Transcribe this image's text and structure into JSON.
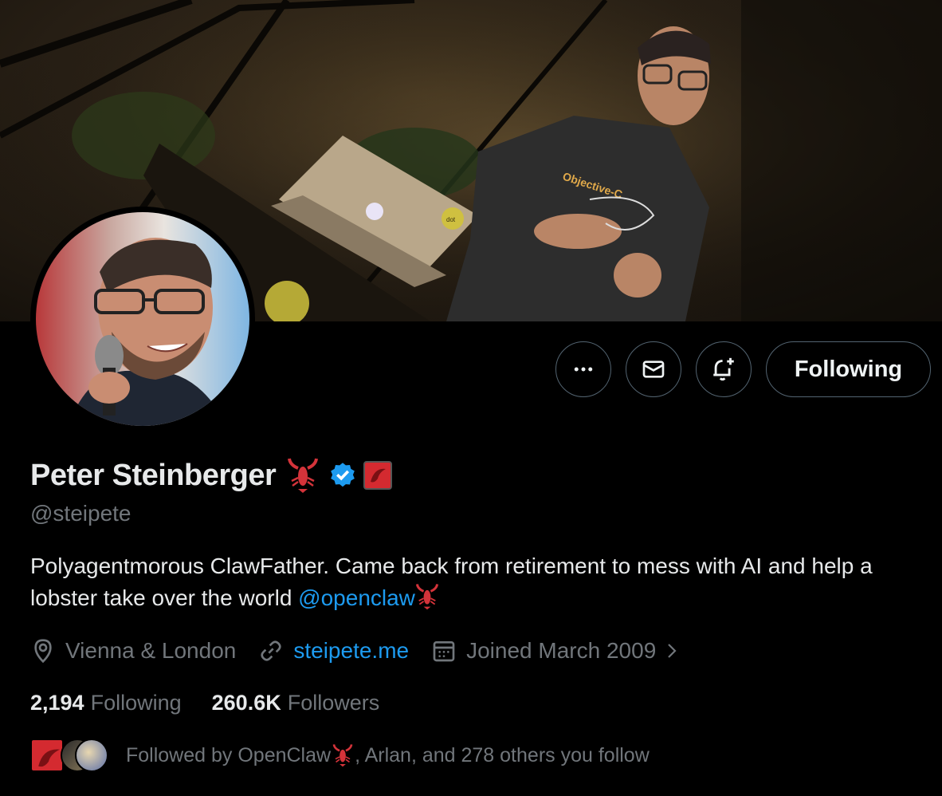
{
  "profile": {
    "display_name": "Peter Steinberger",
    "handle": "@steipete",
    "bio_text": "Polyagentmorous ClawFather. Came back from retirement to mess with AI and help a lobster take over the world ",
    "bio_mention": "@openclaw",
    "location": "Vienna & London",
    "website": "steipete.me",
    "joined": "Joined March 2009",
    "verified": true,
    "name_emoji": "lobster-emoji"
  },
  "banner": {
    "shirt_text": "Objective-C",
    "sticker_text": "dot"
  },
  "actions": {
    "more_icon": "more-icon",
    "message_icon": "mail-icon",
    "notify_icon": "bell-plus-icon",
    "follow_label": "Following"
  },
  "stats": {
    "following_count": "2,194",
    "following_label": "Following",
    "followers_count": "260.6K",
    "followers_label": "Followers"
  },
  "followed_by": {
    "text_before": "Followed by OpenClaw",
    "text_after": ", Arlan, and 278 others you follow"
  },
  "colors": {
    "accent": "#1d9bf0",
    "muted": "#71767b",
    "text": "#e7e9ea",
    "border": "#536471"
  }
}
